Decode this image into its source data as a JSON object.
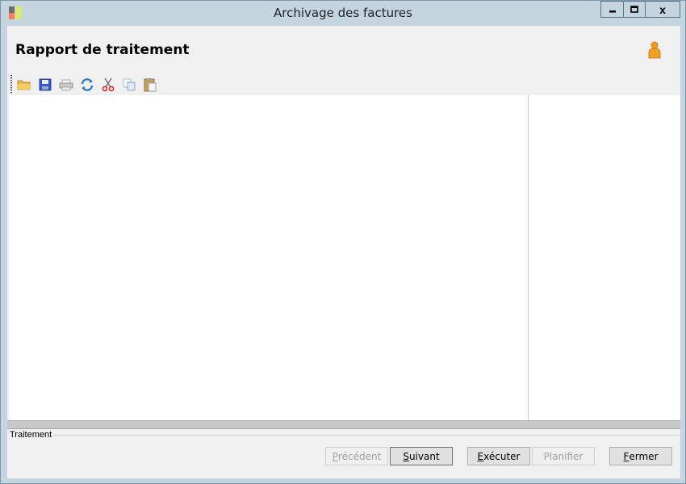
{
  "window": {
    "title": "Archivage des factures",
    "minimize_icon": "minimize-icon",
    "maximize_icon": "maximize-icon",
    "close_icon": "close-icon",
    "close_label": "x"
  },
  "header": {
    "title": "Rapport de traitement",
    "user_icon": "user-icon"
  },
  "toolbar": {
    "items": [
      {
        "icon": "open-folder-icon",
        "enabled": true
      },
      {
        "icon": "save-icon",
        "enabled": true
      },
      {
        "icon": "print-icon",
        "enabled": false
      },
      {
        "icon": "refresh-icon",
        "enabled": true
      },
      {
        "icon": "cut-icon",
        "enabled": true
      },
      {
        "icon": "copy-icon",
        "enabled": false
      },
      {
        "icon": "paste-icon",
        "enabled": true
      }
    ]
  },
  "footer": {
    "group_label": "Traitement",
    "buttons": {
      "previous": {
        "label": "Précédent",
        "mnemonic": "P",
        "rest": "récédent",
        "enabled": false
      },
      "next": {
        "label": "Suivant",
        "mnemonic": "S",
        "rest": "uivant",
        "enabled": true
      },
      "execute": {
        "label": "Exécuter",
        "mnemonic": "E",
        "rest": "xécuter",
        "enabled": true
      },
      "schedule": {
        "label": "Planifier",
        "enabled": false
      },
      "close": {
        "label": "Fermer",
        "mnemonic": "F",
        "rest": "ermer",
        "enabled": true
      }
    }
  },
  "colors": {
    "frame": "#c5d5e0",
    "client": "#f0f0f0",
    "content": "#ffffff"
  }
}
